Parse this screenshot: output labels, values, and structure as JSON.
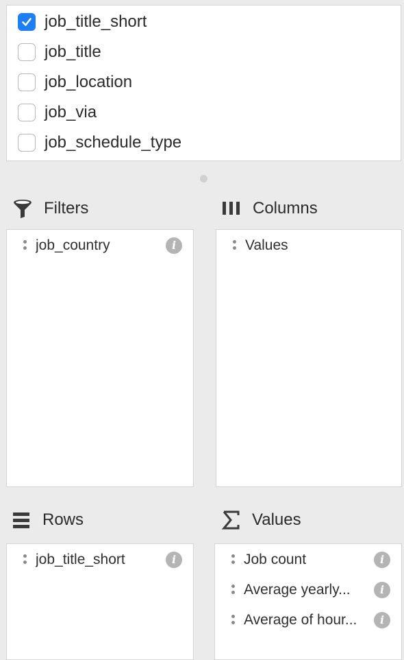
{
  "field_list": {
    "fields": [
      {
        "label": "job_title_short",
        "checked": true
      },
      {
        "label": "job_title",
        "checked": false
      },
      {
        "label": "job_location",
        "checked": false
      },
      {
        "label": "job_via",
        "checked": false
      },
      {
        "label": "job_schedule_type",
        "checked": false
      }
    ]
  },
  "sections": {
    "filters": {
      "title": "Filters",
      "icon": "filter-funnel-icon",
      "items": [
        {
          "label": "job_country"
        }
      ]
    },
    "columns": {
      "title": "Columns",
      "icon": "columns-icon",
      "items": [
        {
          "label": "Values"
        }
      ]
    },
    "rows": {
      "title": "Rows",
      "icon": "rows-icon",
      "items": [
        {
          "label": "job_title_short"
        }
      ]
    },
    "values": {
      "title": "Values",
      "icon": "sigma-icon",
      "items": [
        {
          "label": "Job count"
        },
        {
          "label": "Average yearly..."
        },
        {
          "label": "Average of hour..."
        }
      ]
    }
  },
  "info_glyph": "i",
  "colors": {
    "accent": "#1f7ef1",
    "panel_background": "#ebebeb",
    "zone_background": "#ffffff",
    "icon_gray": "#b4b4b4"
  }
}
